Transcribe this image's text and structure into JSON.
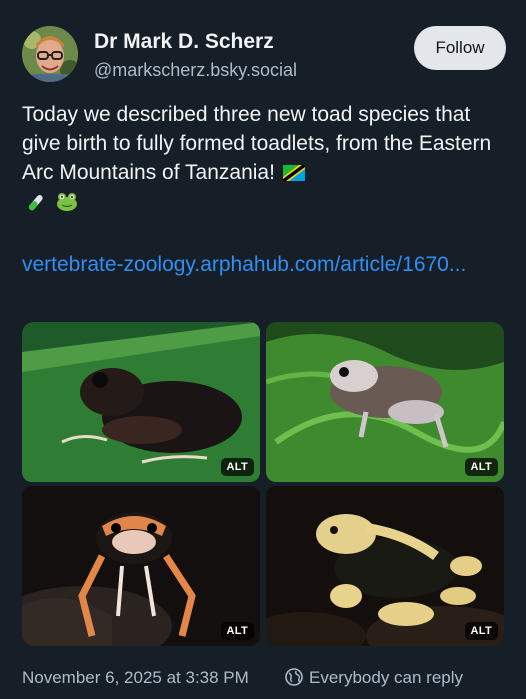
{
  "author": {
    "display_name": "Dr Mark D. Scherz",
    "handle": "@markscherz.bsky.social"
  },
  "actions": {
    "follow_label": "Follow"
  },
  "post": {
    "text": "Today we described three new toad species that give birth to fully formed toadlets, from the Eastern Arc Mountains of Tanzania!",
    "emoji": [
      "tanzania-flag",
      "test-tube",
      "frog"
    ],
    "link_text": "vertebrate-zoology.arphahub.com/article/1670..."
  },
  "images": [
    {
      "subject": "dark toad on green leaf",
      "alt_label": "ALT"
    },
    {
      "subject": "grey-brown toad on fern",
      "alt_label": "ALT"
    },
    {
      "subject": "dark toad with orange markings",
      "alt_label": "ALT"
    },
    {
      "subject": "black and yellow toad",
      "alt_label": "ALT"
    }
  ],
  "footer": {
    "timestamp": "November 6, 2025 at 3:38 PM",
    "reply_setting": "Everybody can reply",
    "reply_icon": "earth-icon"
  },
  "colors": {
    "background": "#161e27",
    "link": "#2f8ff5",
    "muted_text": "#aebbc9",
    "follow_button": "#e3e7ec"
  }
}
